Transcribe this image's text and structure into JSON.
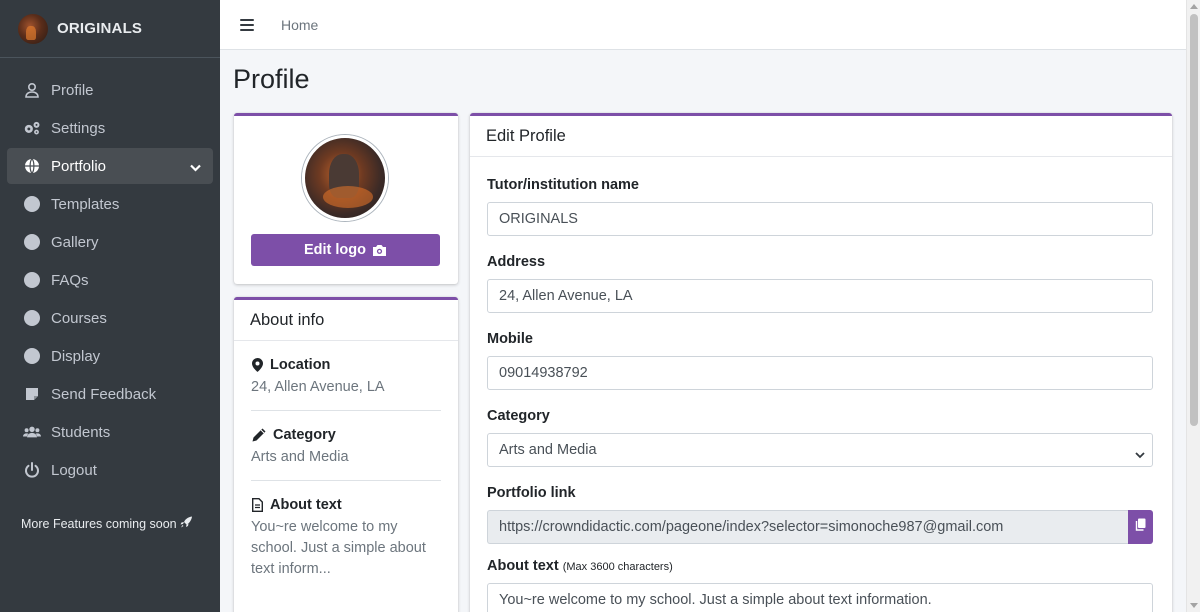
{
  "brand": {
    "name": "ORIGINALS"
  },
  "sidebar": {
    "items": [
      {
        "label": "Profile",
        "icon": "user-icon"
      },
      {
        "label": "Settings",
        "icon": "gears-icon"
      },
      {
        "label": "Portfolio",
        "icon": "globe-icon",
        "active": true
      },
      {
        "label": "Templates",
        "icon": "circle-icon"
      },
      {
        "label": "Gallery",
        "icon": "circle-icon"
      },
      {
        "label": "FAQs",
        "icon": "circle-icon"
      },
      {
        "label": "Courses",
        "icon": "circle-icon"
      },
      {
        "label": "Display",
        "icon": "circle-icon"
      },
      {
        "label": "Send Feedback",
        "icon": "sticky-note-icon"
      },
      {
        "label": "Students",
        "icon": "users-icon"
      },
      {
        "label": "Logout",
        "icon": "power-icon"
      }
    ],
    "footer_text": "More Features coming soon"
  },
  "topbar": {
    "home_link": "Home"
  },
  "page": {
    "title": "Profile"
  },
  "logo_card": {
    "edit_button_label": "Edit logo"
  },
  "about_card": {
    "title": "About info",
    "items": [
      {
        "label": "Location",
        "value": "24, Allen Avenue, LA",
        "icon": "map-marker-icon"
      },
      {
        "label": "Category",
        "value": "Arts and Media",
        "icon": "pencil-icon"
      },
      {
        "label": "About text",
        "value": "You~re welcome to my school. Just a simple about text inform...",
        "icon": "file-text-icon"
      }
    ]
  },
  "edit_profile": {
    "title": "Edit Profile",
    "fields": {
      "name": {
        "label": "Tutor/institution name",
        "value": "ORIGINALS"
      },
      "address": {
        "label": "Address",
        "value": "24, Allen Avenue, LA"
      },
      "mobile": {
        "label": "Mobile",
        "value": "09014938792"
      },
      "category": {
        "label": "Category",
        "value": "Arts and Media"
      },
      "portfolio_link": {
        "label": "Portfolio link",
        "value": "https://crowndidactic.com/pageone/index?selector=simonoche987@gmail.com"
      },
      "about_text": {
        "label": "About text",
        "hint": "(Max 3600 characters)",
        "value": "You~re welcome to my school. Just a simple about text information."
      }
    }
  },
  "colors": {
    "accent": "#7d4fa8",
    "sidebar_bg": "#343a40",
    "sidebar_active": "#494e53"
  }
}
